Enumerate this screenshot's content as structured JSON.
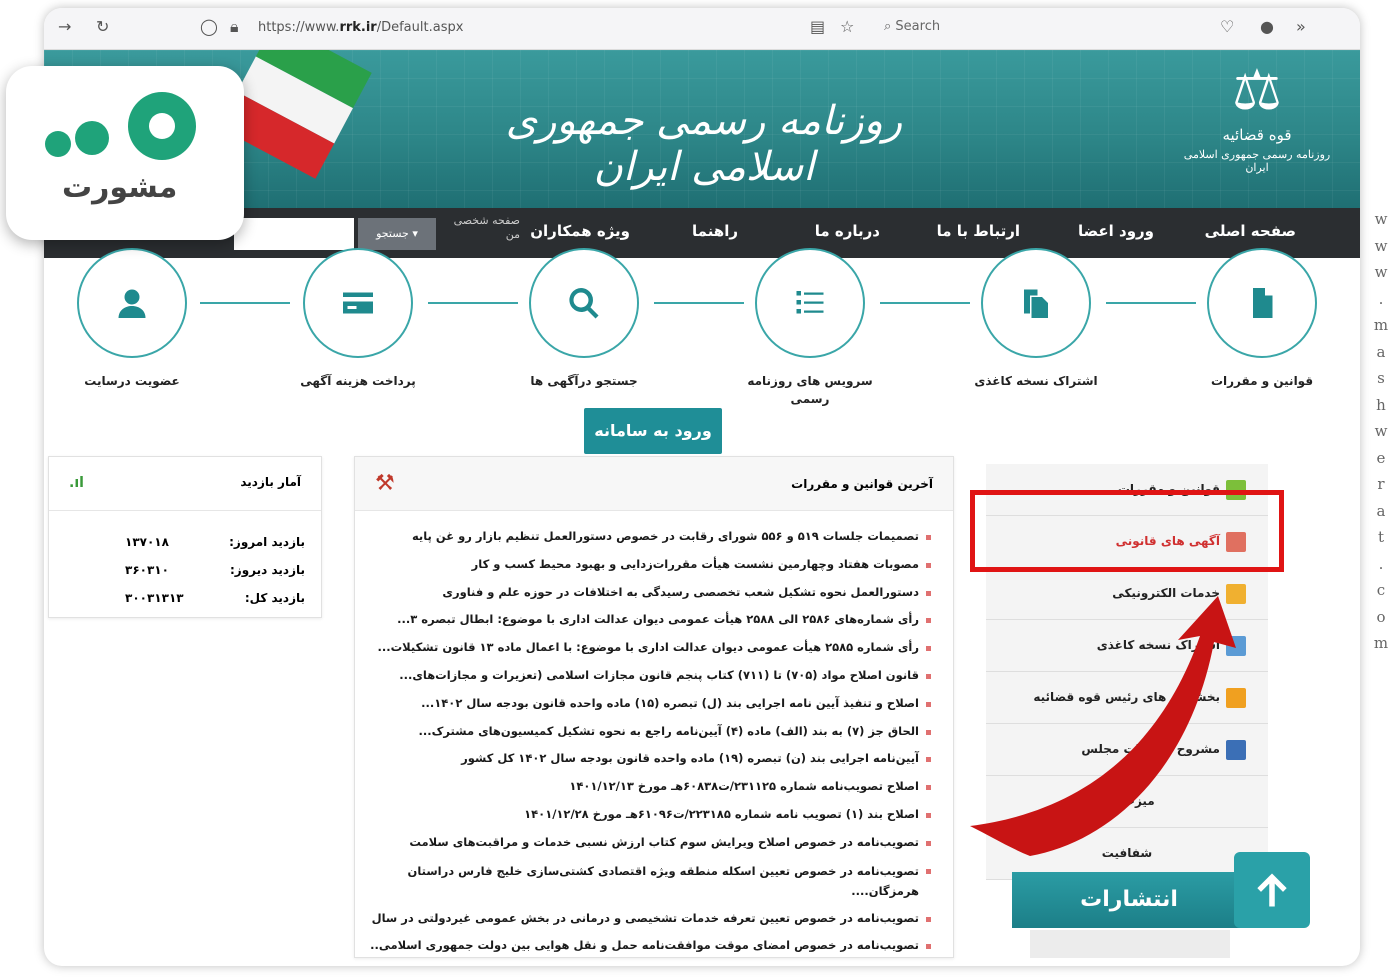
{
  "browser": {
    "url_prefix": "https://www.",
    "url_domain": "rrk.ir",
    "url_path": "/Default.aspx",
    "search_placeholder": "Search"
  },
  "header": {
    "title": "روزنامه رسمی جمهوری اسلامی ایران",
    "emblem_line1": "قوه قضائیه",
    "emblem_line2": "روزنامه رسمی جمهوری اسلامی ایران"
  },
  "nav": {
    "items": [
      "صفحه اصلی",
      "ورود اعضا",
      "ارتباط با ما",
      "درباره ما",
      "راهنما",
      "ویژه همکاران"
    ],
    "search_button": "جستجو",
    "small_text": "صفحه شخصی من"
  },
  "services": [
    {
      "label": "قوانین و مقررات",
      "icon": "document-icon"
    },
    {
      "label": "اشتراک نسخه کاغذی",
      "icon": "copy-icon"
    },
    {
      "label": "سرویس های روزنامه رسمی",
      "icon": "list-icon"
    },
    {
      "label": "جستجو درآگهی ها",
      "icon": "search-icon"
    },
    {
      "label": "پرداخت هزینه آگهی",
      "icon": "card-icon"
    },
    {
      "label": "عضویت درسایت",
      "icon": "user-icon"
    }
  ],
  "enter_button": "ورود به سامانه",
  "stats": {
    "title": "آمار بازدید",
    "rows": [
      {
        "label": "بازدید امروز:",
        "value": "۱۳۷۰۱۸"
      },
      {
        "label": "بازدید دیروز:",
        "value": "۳۶۰۳۱۰"
      },
      {
        "label": "بازدید کل:",
        "value": "۳۰۰۳۱۳۱۳"
      }
    ]
  },
  "news": {
    "title": "آخرین قوانین و مقررات",
    "items": [
      "تصمیمات جلسات ۵۱۹ و ۵۵۶ شورای رقابت در خصوص دستورالعمل تنظیم بازار رو غن پایه",
      "مصوبات هفتاد وچهارمین نشست هیأت مقررات‌زدایی و بهبود محیط کسب و کار",
      "دستورالعمل نحوه تشکیل شعب تخصصی رسیدگی به اختلافات در حوزه علم و فناوری",
      "رأی شماره‌های ۲۵۸۶ الی ۲۵۸۸ هیأت عمومی دیوان عدالت اداری با موضوع: ابطال تبصره ۳...",
      "رأی شماره ۲۵۸۵ هیأت عمومی دیوان عدالت اداری با موضوع: با اعمال ماده ۱۳ قانون تشکیلات...",
      "قانون اصلاح مواد (۷۰۵) تا (۷۱۱) کتاب پنجم قانون مجازات اسلامی (تعزیرات و مجازات‌های...",
      "اصلاح و تنفیذ آیین نامه اجرایی بند (ل) تبصره (۱۵) ماده واحده قانون بودجه سال ۱۴۰۲...",
      "الحاق جز (۷) به بند (الف) ماده (۴) آیین‌نامه راجع به نحوه تشکیل کمیسیون‌های مشترک...",
      "آیین‌نامه اجرایی بند (ن) تبصره (۱۹) ماده واحده قانون بودجه سال ۱۴۰۲ کل کشور",
      "اصلاح تصویب‌نامه شماره ۲۳۱۱۲۵/ت۶۰۸۳۸هـ مورخ ۱۴۰۱/۱۲/۱۳",
      "اصلاح بند (۱) تصویب نامه شماره ۲۲۳۱۸۵/ت۶۱۰۹۶هـ مورخ ۱۴۰۱/۱۲/۲۸",
      "تصویب‌نامه در خصوص اصلاح ویرایش سوم کتاب ارزش نسبی خدمات و مراقبت‌های سلامت",
      "تصویب‌نامه در خصوص تعیین اسکله منطقه ویژه اقتصادی کشتی‌سازی خلیج فارس دراستان هرمزگان....",
      "تصویب‌نامه در خصوص تعیین تعرفه خدمات تشخیصی و درمانی در بخش عمومی غیردولتی در سال...",
      "تصویب‌نامه در خصوص امضای موقت موافقت‌نامه حمل و نقل هوایی بین دولت جمهوری اسلامی..."
    ]
  },
  "side_menu": [
    {
      "label": "قوانین و مقررات",
      "color": "#7cbf3a"
    },
    {
      "label": "آگهی های قانونی",
      "color": "#e07060"
    },
    {
      "label": "خدمات الکترونیکی",
      "color": "#f0b030"
    },
    {
      "label": "اشتراک نسخه کاغذی",
      "color": "#5b9bd5"
    },
    {
      "label": "بخشنامه های رئیس قوه قضائیه",
      "color": "#f0a020"
    },
    {
      "label": "مشروح مذاکرات مجلس",
      "color": "#3b6fb6"
    },
    {
      "label": "میزخدمت",
      "color": ""
    },
    {
      "label": "شفافیت",
      "color": ""
    }
  ],
  "publications": "انتشارات",
  "logo": {
    "word": "مشورت"
  },
  "watermark": "www.mashwerat.com",
  "colors": {
    "teal": "#2d8688",
    "nav": "#2b2e31",
    "highlight": "#e01414",
    "arrow": "#c81414"
  }
}
